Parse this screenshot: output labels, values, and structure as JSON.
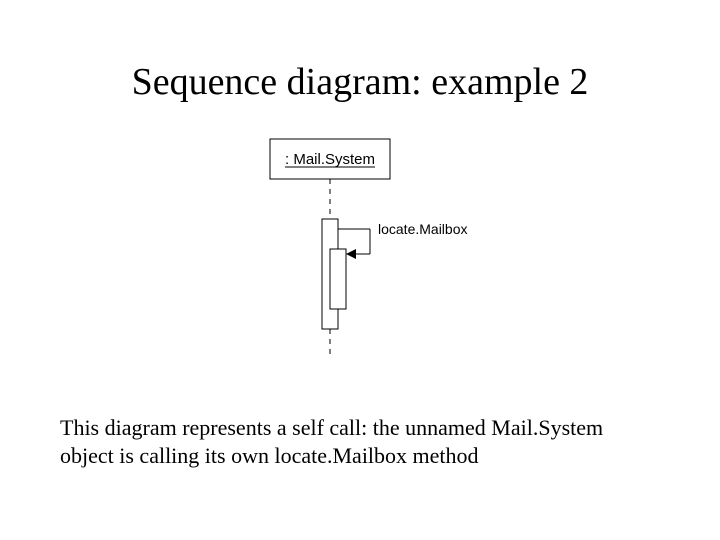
{
  "title": "Sequence diagram: example 2",
  "diagram": {
    "participant_label": ": Mail.System",
    "message_label": "locate.Mailbox"
  },
  "caption": "This diagram represents a self call: the unnamed Mail.System object is calling its own locate.Mailbox method"
}
